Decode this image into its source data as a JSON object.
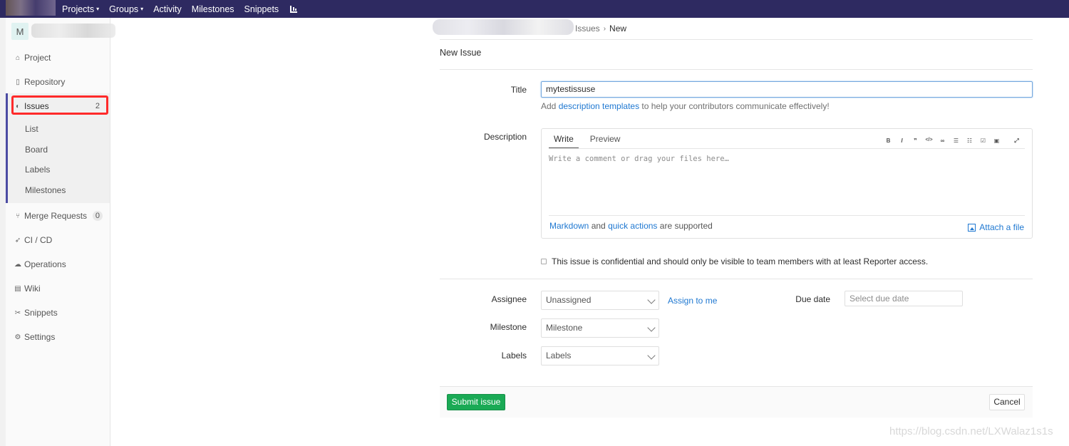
{
  "navbar": {
    "links": [
      {
        "label": "Projects",
        "caret": "⌄"
      },
      {
        "label": "Groups",
        "caret": "⌄"
      },
      {
        "label": "Activity"
      },
      {
        "label": "Milestones"
      },
      {
        "label": "Snippets"
      }
    ],
    "chart_icon": "bar-chart-icon"
  },
  "sidebar": {
    "project_avatar": "M",
    "items": [
      {
        "label": "Project",
        "icon": "home-icon"
      },
      {
        "label": "Repository",
        "icon": "file-icon"
      },
      {
        "label": "Issues",
        "icon": "issues-icon",
        "count": "2"
      },
      {
        "label": "Merge Requests",
        "icon": "merge-icon",
        "count": "0"
      },
      {
        "label": "CI / CD",
        "icon": "rocket-icon"
      },
      {
        "label": "Operations",
        "icon": "cloud-icon"
      },
      {
        "label": "Wiki",
        "icon": "book-icon"
      },
      {
        "label": "Snippets",
        "icon": "scissors-icon"
      },
      {
        "label": "Settings",
        "icon": "gear-icon"
      }
    ],
    "issues_sub": [
      "List",
      "Board",
      "Labels",
      "Milestones"
    ]
  },
  "breadcrumb": {
    "parent": "Issues",
    "separator": "›",
    "current": "New"
  },
  "page_title": "New Issue",
  "form": {
    "title_label": "Title",
    "title_value": "mytestissuse",
    "helper_prefix": "Add ",
    "helper_link": "description templates",
    "helper_suffix": " to help your contributors communicate effectively!",
    "description_label": "Description",
    "tab_write": "Write",
    "tab_preview": "Preview",
    "toolbar": [
      "B",
      "I",
      "❞",
      "</>",
      "∞",
      "☰",
      "☷",
      "☑",
      "▣",
      "⤢"
    ],
    "placeholder": "Write a comment or drag your files here…",
    "markdown_link": "Markdown",
    "and_text": " and ",
    "quick_actions_link": "quick actions",
    "supported_text": " are supported",
    "attach_label": "Attach a file",
    "confidential_text": "This issue is confidential and should only be visible to team members with at least Reporter access.",
    "assignee_label": "Assignee",
    "assignee_value": "Unassigned",
    "assign_me": "Assign to me",
    "due_label": "Due date",
    "due_placeholder": "Select due date",
    "milestone_label": "Milestone",
    "milestone_value": "Milestone",
    "labels_label": "Labels",
    "labels_value": "Labels",
    "submit": "Submit issue",
    "cancel": "Cancel"
  },
  "watermark": "https://blog.csdn.net/LXWalaz1s1s"
}
